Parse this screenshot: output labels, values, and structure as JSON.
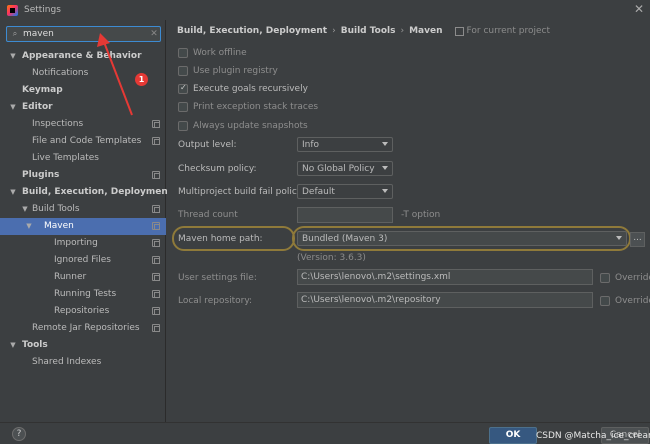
{
  "window": {
    "title": "Settings"
  },
  "search": {
    "value": "maven"
  },
  "tree": [
    {
      "label": "Appearance & Behavior",
      "bold": true,
      "expanded": true,
      "level": 0,
      "arrow": "▼"
    },
    {
      "label": "Notifications",
      "level": 1
    },
    {
      "label": "Keymap",
      "bold": true,
      "level": 0
    },
    {
      "label": "Editor",
      "bold": true,
      "expanded": true,
      "level": 0,
      "arrow": "▼"
    },
    {
      "label": "Inspections",
      "level": 1,
      "cfg": true
    },
    {
      "label": "File and Code Templates",
      "level": 1,
      "cfg": true
    },
    {
      "label": "Live Templates",
      "level": 1
    },
    {
      "label": "Plugins",
      "bold": true,
      "level": 0,
      "cfg": true
    },
    {
      "label": "Build, Execution, Deployment",
      "bold": true,
      "expanded": true,
      "level": 0,
      "arrow": "▼"
    },
    {
      "label": "Build Tools",
      "level": 1,
      "arrow": "▼",
      "cfg": true
    },
    {
      "label": "Maven",
      "level": 2,
      "arrow": "▼",
      "cfg": true,
      "selected": true
    },
    {
      "label": "Importing",
      "level": 3,
      "cfg": true
    },
    {
      "label": "Ignored Files",
      "level": 3,
      "cfg": true
    },
    {
      "label": "Runner",
      "level": 3,
      "cfg": true
    },
    {
      "label": "Running Tests",
      "level": 3,
      "cfg": true
    },
    {
      "label": "Repositories",
      "level": 3,
      "cfg": true
    },
    {
      "label": "Remote Jar Repositories",
      "level": 1,
      "cfg": true
    },
    {
      "label": "Tools",
      "bold": true,
      "expanded": true,
      "level": 0,
      "arrow": "▼"
    },
    {
      "label": "Shared Indexes",
      "level": 1
    }
  ],
  "breadcrumb": {
    "part1": "Build, Execution, Deployment",
    "part2": "Build Tools",
    "part3": "Maven",
    "sep": "›",
    "project": "For current project"
  },
  "options": {
    "work_offline": {
      "label": "Work offline",
      "checked": false
    },
    "use_plugin_registry": {
      "label": "Use plugin registry",
      "checked": false
    },
    "execute_goals": {
      "label": "Execute goals recursively",
      "checked": true
    },
    "print_traces": {
      "label": "Print exception stack traces",
      "checked": false
    },
    "update_snapshots": {
      "label": "Always update snapshots",
      "checked": false
    }
  },
  "form": {
    "output_level": {
      "label": "Output level:",
      "value": "Info"
    },
    "checksum_policy": {
      "label": "Checksum policy:",
      "value": "No Global Policy"
    },
    "multiproject_policy": {
      "label": "Multiproject build fail policy:",
      "value": "Default"
    },
    "thread_count": {
      "label": "Thread count",
      "value": "",
      "hint": "-T option"
    },
    "maven_home": {
      "label": "Maven home path:",
      "value": "Bundled (Maven 3)",
      "browse": "...",
      "version": "(Version: 3.6.3)"
    },
    "user_settings": {
      "label": "User settings file:",
      "value": "C:\\Users\\lenovo\\.m2\\settings.xml",
      "override": "Override"
    },
    "local_repo": {
      "label": "Local repository:",
      "value": "C:\\Users\\lenovo\\.m2\\repository",
      "override": "Override"
    }
  },
  "buttons": {
    "help": "?",
    "ok": "OK",
    "cancel": "Cancel"
  },
  "watermark": "CSDN @Matcha_ice_cream",
  "annotation": {
    "badge": "1"
  },
  "colors": {
    "accent": "#4b6eaf",
    "highlight_ring": "#8f7a3a",
    "annotation": "#e53935",
    "primary_button": "#365880"
  }
}
